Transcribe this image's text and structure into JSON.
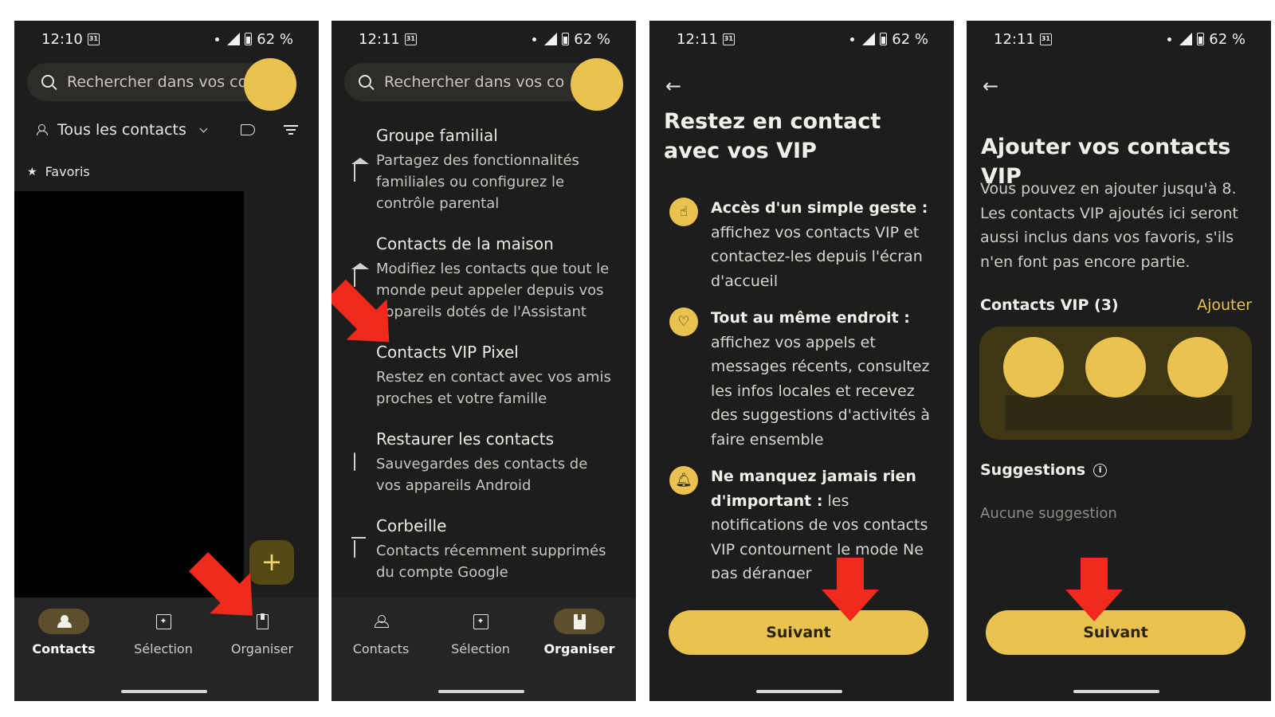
{
  "status": {
    "screens": [
      {
        "time": "12:10",
        "battery": "62 %"
      },
      {
        "time": "12:11",
        "battery": "62 %"
      },
      {
        "time": "12:11",
        "battery": "62 %"
      },
      {
        "time": "12:11",
        "battery": "62 %"
      }
    ],
    "calendar_glyph": "31"
  },
  "screen1": {
    "search_placeholder": "Rechercher dans vos co...",
    "filter_label": "Tous les contacts",
    "favorites_label": "Favoris",
    "fab_label": "+"
  },
  "screen2": {
    "search_placeholder": "Rechercher dans vos co...",
    "menu": [
      {
        "title": "Groupe familial",
        "desc": "Partagez des fonctionnalités familiales ou configurez le contrôle parental",
        "icon": "family-house-icon"
      },
      {
        "title": "Contacts de la maison",
        "desc": "Modifiez les contacts que tout le monde peut appeler depuis vos appareils dotés de l'Assistant",
        "icon": "home-contacts-icon"
      },
      {
        "title": "Contacts VIP Pixel",
        "desc": "Restez en contact avec vos amis proches et votre famille",
        "icon": "heart-person-icon"
      },
      {
        "title": "Restaurer les contacts",
        "desc": "Sauvegardes des contacts de vos appareils Android",
        "icon": "cloud-restore-icon"
      },
      {
        "title": "Corbeille",
        "desc": "Contacts récemment supprimés du compte Google",
        "icon": "trash-icon"
      }
    ]
  },
  "nav": {
    "contacts": "Contacts",
    "selection": "Sélection",
    "organiser": "Organiser"
  },
  "screen3": {
    "title": "Restez en contact avec vos VIP",
    "features": [
      {
        "bold": "Accès d'un simple geste :",
        "text": " affichez vos contacts VIP et contactez-les depuis l'écran d'accueil",
        "icon": "tap-icon"
      },
      {
        "bold": "Tout au même endroit :",
        "text": " affichez vos appels et messages récents, consultez les infos locales et recevez des suggestions d'activités à faire ensemble",
        "icon": "heart-icon"
      },
      {
        "bold": "Ne manquez jamais rien d'important :",
        "text": " les notifications de vos contacts VIP contournent le mode Ne pas déranger",
        "icon": "bell-icon"
      }
    ],
    "button": "Suivant"
  },
  "screen4": {
    "title": "Ajouter vos contacts VIP",
    "description": "Vous pouvez en ajouter jusqu'à 8. Les contacts VIP ajoutés ici seront aussi inclus dans vos favoris, s'ils n'en font pas encore partie.",
    "vip_label": "Contacts VIP (3)",
    "add_label": "Ajouter",
    "suggestions_label": "Suggestions",
    "no_suggestions": "Aucune suggestion",
    "button": "Suivant"
  },
  "colors": {
    "accent": "#e9c24f",
    "background": "#1d1d1d",
    "annotation_arrow": "#f02b1d"
  }
}
